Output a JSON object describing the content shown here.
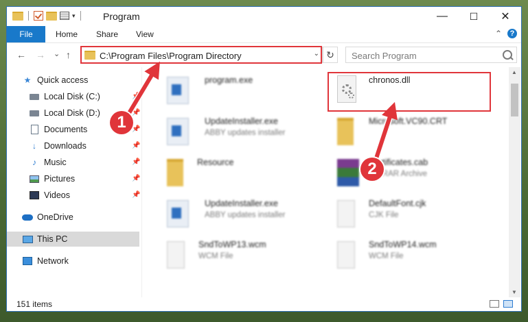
{
  "window": {
    "title": "Program",
    "controls": {
      "minimize": "—",
      "maximize": "☐",
      "close": "✕"
    }
  },
  "ribbon": {
    "file_tab": "File",
    "tabs": [
      "Home",
      "Share",
      "View"
    ],
    "help": "?",
    "collapse": "⌃"
  },
  "navigation": {
    "back": "←",
    "forward": "→",
    "recent": "⌄",
    "up": "↑",
    "address": "C:\\Program Files\\Program Directory",
    "address_dropdown": "⌄",
    "refresh": "↻",
    "search_placeholder": "Search Program"
  },
  "sidebar": {
    "items": [
      {
        "label": "Quick access",
        "icon": "star-icon"
      },
      {
        "label": "Local Disk (C:)",
        "icon": "drive-icon",
        "pinned": true
      },
      {
        "label": "Local Disk (D:)",
        "icon": "drive-icon",
        "pinned": true
      },
      {
        "label": "Documents",
        "icon": "documents-icon",
        "pinned": true
      },
      {
        "label": "Downloads",
        "icon": "download-icon",
        "pinned": true
      },
      {
        "label": "Music",
        "icon": "music-icon",
        "pinned": true
      },
      {
        "label": "Pictures",
        "icon": "pictures-icon",
        "pinned": true
      },
      {
        "label": "Videos",
        "icon": "videos-icon",
        "pinned": true
      },
      {
        "label": "OneDrive",
        "icon": "cloud-icon"
      },
      {
        "label": "This PC",
        "icon": "computer-icon",
        "selected": true
      },
      {
        "label": "Network",
        "icon": "network-icon"
      }
    ]
  },
  "files": [
    {
      "name": "program.exe",
      "type": "",
      "icon": "program-icon"
    },
    {
      "name": "chronos.dll",
      "type": "",
      "icon": "dll-gear-icon",
      "highlighted": true
    },
    {
      "name": "UpdateInstaller.exe",
      "type": "ABBY updates installer",
      "icon": "installer-icon"
    },
    {
      "name": "Microsoft.VC90.CRT",
      "type": "",
      "icon": "folder-icon"
    },
    {
      "name": "Resource",
      "type": "",
      "icon": "folder-icon"
    },
    {
      "name": "Certificates.cab",
      "type": "WinRAR Archive",
      "icon": "archive-icon"
    },
    {
      "name": "UpdateInstaller.exe",
      "type": "ABBY updates installer",
      "icon": "installer-icon"
    },
    {
      "name": "DefaultFont.cjk",
      "type": "CJK File",
      "icon": "file-icon"
    },
    {
      "name": "SndToWP13.wcm",
      "type": "WCM File",
      "icon": "file-icon"
    },
    {
      "name": "SndToWP14.wcm",
      "type": "WCM File",
      "icon": "file-icon"
    }
  ],
  "status": {
    "item_count": "151 items"
  },
  "annotations": {
    "step1": "1",
    "step2": "2",
    "highlight_color": "#e0353a"
  }
}
